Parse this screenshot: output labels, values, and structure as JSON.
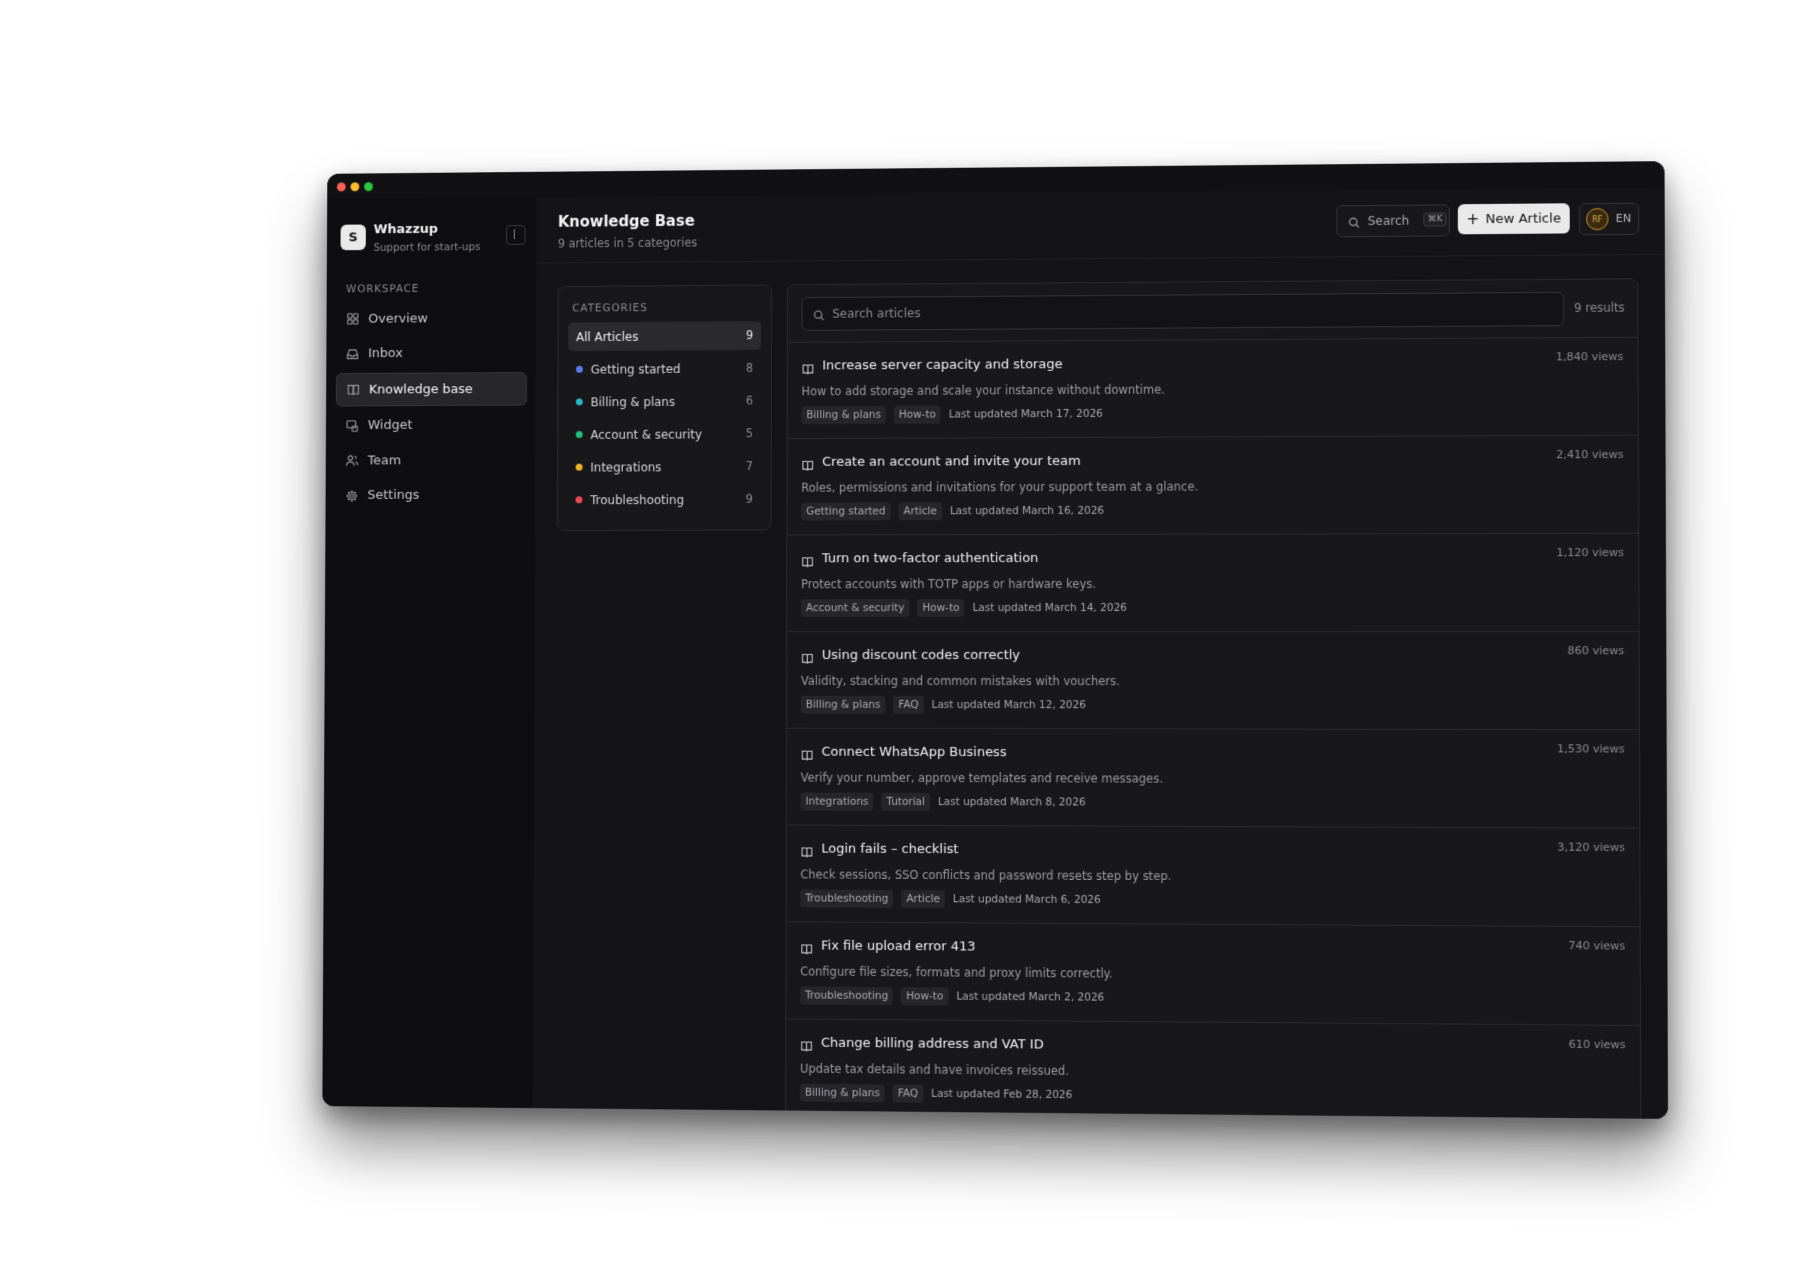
{
  "brand": {
    "logo_letter": "S",
    "name": "Whazzup",
    "tagline": "Support for start-ups"
  },
  "sidebar": {
    "section_label": "WORKSPACE",
    "items": [
      {
        "label": "Overview",
        "icon": "grid-icon",
        "active": false
      },
      {
        "label": "Inbox",
        "icon": "inbox-icon",
        "active": false
      },
      {
        "label": "Knowledge base",
        "icon": "book-icon",
        "active": true
      },
      {
        "label": "Widget",
        "icon": "widget-icon",
        "active": false
      },
      {
        "label": "Team",
        "icon": "users-icon",
        "active": false
      },
      {
        "label": "Settings",
        "icon": "gear-icon",
        "active": false
      }
    ]
  },
  "header": {
    "title": "Knowledge Base",
    "subtitle": "9 articles in 5 categories",
    "search_label": "Search",
    "search_shortcut": "⌘K",
    "new_article_label": "New Article",
    "avatar_initials": "RF",
    "language": "EN"
  },
  "categories": {
    "title": "CATEGORIES",
    "items": [
      {
        "label": "All Articles",
        "count": "9",
        "color": "",
        "active": true
      },
      {
        "label": "Getting started",
        "count": "8",
        "color": "#5b7cf0",
        "active": false
      },
      {
        "label": "Billing & plans",
        "count": "6",
        "color": "#22b8c8",
        "active": false
      },
      {
        "label": "Account & security",
        "count": "5",
        "color": "#22c07a",
        "active": false
      },
      {
        "label": "Integrations",
        "count": "7",
        "color": "#f0b429",
        "active": false
      },
      {
        "label": "Troubleshooting",
        "count": "9",
        "color": "#f04a5a",
        "active": false
      }
    ]
  },
  "articles": {
    "search_placeholder": "Search articles",
    "results": "9 results",
    "items": [
      {
        "title": "Increase server capacity and storage",
        "desc": "How to add storage and scale your instance without downtime.",
        "tags": [
          "Billing & plans",
          "How-to"
        ],
        "updated": "Last updated March 17, 2026",
        "views": "1,840 views"
      },
      {
        "title": "Create an account and invite your team",
        "desc": "Roles, permissions and invitations for your support team at a glance.",
        "tags": [
          "Getting started",
          "Article"
        ],
        "updated": "Last updated March 16, 2026",
        "views": "2,410 views"
      },
      {
        "title": "Turn on two-factor authentication",
        "desc": "Protect accounts with TOTP apps or hardware keys.",
        "tags": [
          "Account & security",
          "How-to"
        ],
        "updated": "Last updated March 14, 2026",
        "views": "1,120 views"
      },
      {
        "title": "Using discount codes correctly",
        "desc": "Validity, stacking and common mistakes with vouchers.",
        "tags": [
          "Billing & plans",
          "FAQ"
        ],
        "updated": "Last updated March 12, 2026",
        "views": "860 views"
      },
      {
        "title": "Connect WhatsApp Business",
        "desc": "Verify your number, approve templates and receive messages.",
        "tags": [
          "Integrations",
          "Tutorial"
        ],
        "updated": "Last updated March 8, 2026",
        "views": "1,530 views"
      },
      {
        "title": "Login fails – checklist",
        "desc": "Check sessions, SSO conflicts and password resets step by step.",
        "tags": [
          "Troubleshooting",
          "Article"
        ],
        "updated": "Last updated March 6, 2026",
        "views": "3,120 views"
      },
      {
        "title": "Fix file upload error 413",
        "desc": "Configure file sizes, formats and proxy limits correctly.",
        "tags": [
          "Troubleshooting",
          "How-to"
        ],
        "updated": "Last updated March 2, 2026",
        "views": "740 views"
      },
      {
        "title": "Change billing address and VAT ID",
        "desc": "Update tax details and have invoices reissued.",
        "tags": [
          "Billing & plans",
          "FAQ"
        ],
        "updated": "Last updated Feb 28, 2026",
        "views": "610 views"
      }
    ]
  }
}
